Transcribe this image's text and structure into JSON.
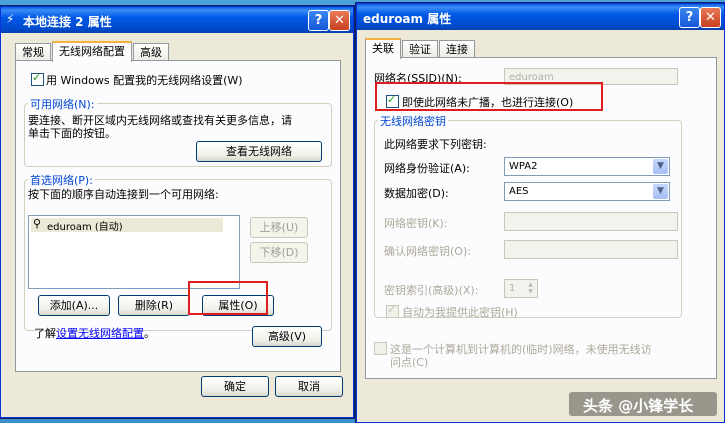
{
  "left_window": {
    "title": "本地连接 2 属性",
    "tabs": [
      "常规",
      "无线网络配置",
      "高级"
    ],
    "use_windows_config": "用 Windows 配置我的无线网络设置(W)",
    "available_group": "可用网络(N):",
    "available_desc_1": "要连接、断开区域内无线网络或查找有关更多信息，请",
    "available_desc_2": "单击下面的按钮。",
    "view_networks_btn": "查看无线网络",
    "preferred_group": "首选网络(P):",
    "preferred_desc": "按下面的顺序自动连接到一个可用网络:",
    "networks": [
      "eduroam (自动)"
    ],
    "move_up_btn": "上移(U)",
    "move_down_btn": "下移(D)",
    "add_btn": "添加(A)...",
    "remove_btn": "删除(R)",
    "properties_btn": "属性(O)",
    "learn_prefix": "了解",
    "learn_link": "设置无线网络配置",
    "learn_suffix": "。",
    "advanced_btn": "高级(V)",
    "ok_btn": "确定",
    "cancel_btn": "取消"
  },
  "right_window": {
    "title": "eduroam 属性",
    "tabs": [
      "关联",
      "验证",
      "连接"
    ],
    "ssid_label": "网络名(SSID)(N):",
    "ssid_value": "eduroam",
    "connect_even_if_not_broadcast": "即使此网络未广播，也进行连接(O)",
    "key_group": "无线网络密钥",
    "key_desc": "此网络要求下列密钥:",
    "auth_label": "网络身份验证(A):",
    "auth_value": "WPA2",
    "encrypt_label": "数据加密(D):",
    "encrypt_value": "AES",
    "netkey_label": "网络密钥(K):",
    "confirm_key_label": "确认网络密钥(O):",
    "key_index_label": "密钥索引(高级)(X):",
    "key_index_value": "1",
    "auto_key_label": "自动为我提供此密钥(H)",
    "adhoc_label_1": "这是一个计算机到计算机的(临时)网络，未使用无线访",
    "adhoc_label_2": "问点(C)"
  },
  "watermark": "头条 @小锋学长"
}
